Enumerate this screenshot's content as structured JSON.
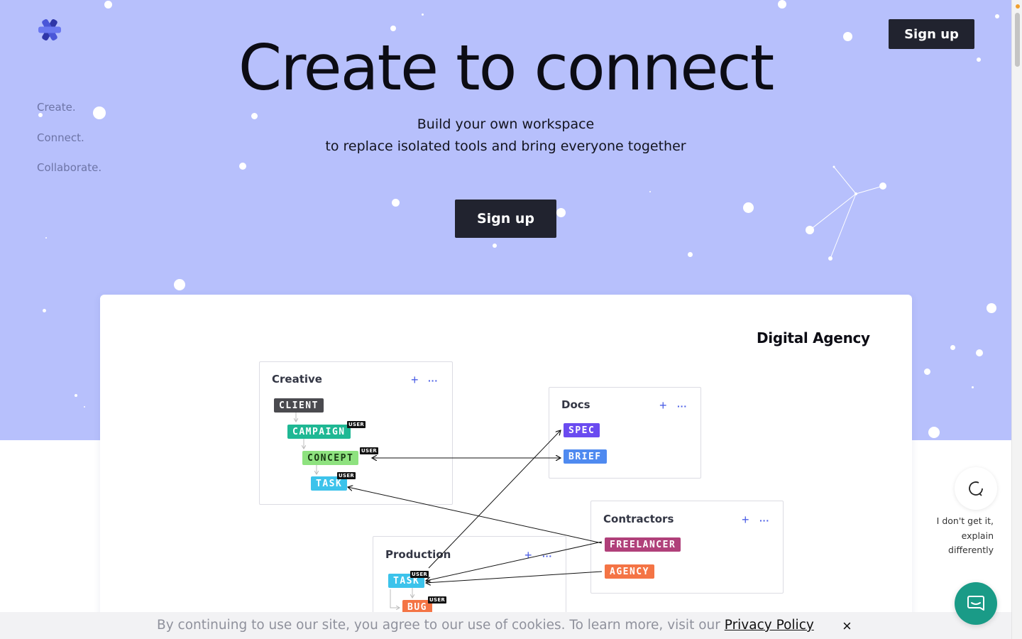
{
  "hero": {
    "headline": "Create to connect",
    "subline_1": "Build your own workspace",
    "subline_2": "to replace isolated tools and bring everyone together",
    "signup_top": "Sign up",
    "signup_main": "Sign up",
    "taglines": [
      "Create.",
      "Connect.",
      "Collaborate."
    ],
    "colors": {
      "background": "#b7c0fc",
      "button": "#21232f"
    }
  },
  "card": {
    "title": "Digital Agency",
    "panels": {
      "creative": {
        "title": "Creative",
        "plus": "+",
        "more": "···",
        "tags": [
          {
            "label": "CLIENT",
            "user": "",
            "color": "#4a4a4f"
          },
          {
            "label": "CAMPAIGN",
            "user": "USER",
            "color": "#1fb894"
          },
          {
            "label": "CONCEPT",
            "user": "USER",
            "color": "#8ee27f"
          },
          {
            "label": "TASK",
            "user": "USER",
            "color": "#3cc3eb"
          }
        ]
      },
      "docs": {
        "title": "Docs",
        "plus": "+",
        "more": "···",
        "tags": [
          {
            "label": "SPEC",
            "color": "#6a4bf0"
          },
          {
            "label": "BRIEF",
            "color": "#4f8af0"
          }
        ]
      },
      "contractors": {
        "title": "Contractors",
        "plus": "+",
        "more": "···",
        "tags": [
          {
            "label": "FREELANCER",
            "color": "#b0407a"
          },
          {
            "label": "AGENCY",
            "color": "#f47445"
          }
        ]
      },
      "production": {
        "title": "Production",
        "plus": "+",
        "more": "···",
        "tags": [
          {
            "label": "TASK",
            "user": "USER",
            "color": "#3cc3eb"
          },
          {
            "label": "BUG",
            "user": "USER",
            "color": "#f47445"
          }
        ]
      }
    }
  },
  "cookie": {
    "text": "By continuing to use our site, you agree to our use of cookies. To learn more, visit our ",
    "link": "Privacy Policy",
    "close": "×"
  },
  "explain": {
    "line1": "I don't get it,",
    "line2": "explain",
    "line3": "differently"
  },
  "icons": {
    "logo": "asterisk-logo-icon",
    "explain": "refresh-circle-icon",
    "chat": "chat-bubble-icon",
    "close": "close-icon"
  }
}
